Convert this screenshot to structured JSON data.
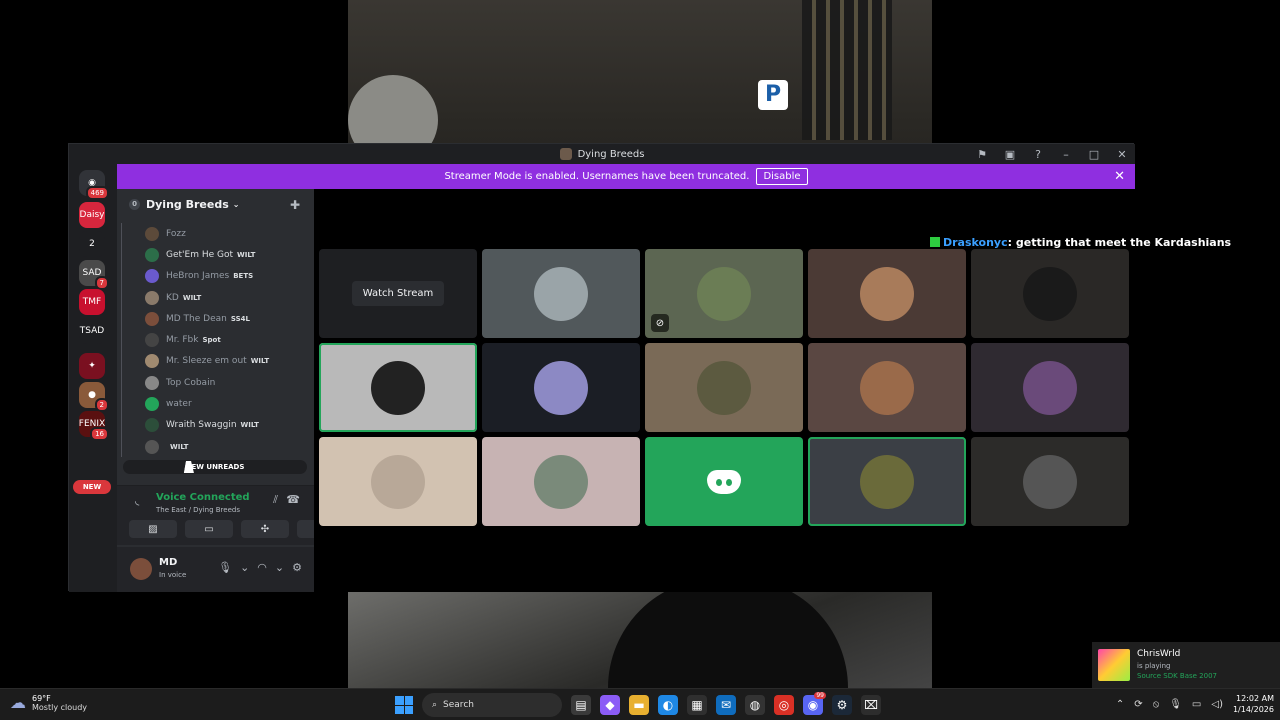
{
  "window": {
    "title": "Dying Breeds",
    "controls": [
      "flag-icon",
      "screen-icon",
      "help-icon",
      "minimize-icon",
      "maximize-icon",
      "close-icon"
    ]
  },
  "banner": {
    "text": "Streamer Mode is enabled. Usernames have been truncated.",
    "button": "Disable"
  },
  "rail": {
    "home_badge": "469",
    "servers": [
      {
        "label": "Daisy",
        "color": "#d7263d",
        "badge": ""
      },
      {
        "label": "2",
        "color": "#1e1f22",
        "badge": ""
      },
      {
        "label": "SAD",
        "color": "#4a4a4a",
        "badge": "7"
      },
      {
        "label": "TMF",
        "color": "#c8102e",
        "badge": ""
      },
      {
        "label": "TSAD",
        "color": "#1e1f22",
        "badge": ""
      },
      {
        "label": "✦",
        "color": "#7a1020",
        "badge": ""
      },
      {
        "label": "●",
        "color": "#8a5a3a",
        "badge": "2"
      },
      {
        "label": "FENIX",
        "color": "#5a1010",
        "badge": "16"
      }
    ],
    "new_label": "NEW"
  },
  "sidebar": {
    "server_name": "Dying Breeds",
    "count": "0",
    "members": [
      {
        "name": "Fozz",
        "tag": "",
        "color": "#5c4a3a",
        "bright": false
      },
      {
        "name": "Get'Em He Got",
        "tag": "WILT",
        "color": "#2c6e49",
        "bright": true
      },
      {
        "name": "HeBron James",
        "tag": "BETS",
        "color": "#6a5acd",
        "bright": false
      },
      {
        "name": "KD",
        "tag": "WILT",
        "color": "#8a7a6a",
        "bright": false
      },
      {
        "name": "MD The Dean",
        "tag": "SS4L",
        "color": "#7b4e3b",
        "bright": false
      },
      {
        "name": "Mr. Fbk",
        "tag": "Spot",
        "color": "#444",
        "bright": false
      },
      {
        "name": "Mr. Sleeze em out",
        "tag": "WILT",
        "color": "#a08a70",
        "bright": false
      },
      {
        "name": "Top Cobain",
        "tag": "",
        "color": "#888",
        "bright": false
      },
      {
        "name": "water",
        "tag": "",
        "color": "#23a55a",
        "bright": false
      },
      {
        "name": "Wraith Swaggin",
        "tag": "WILT",
        "color": "#2c4e3a",
        "bright": true
      },
      {
        "name": "",
        "tag": "WILT",
        "color": "#555",
        "bright": false
      }
    ],
    "new_unreads": "NEW UNREADS"
  },
  "voice": {
    "status": "Voice Connected",
    "channel": "The East / Dying Breeds",
    "buttons": [
      "camera-off-icon",
      "screen-share-icon",
      "activities-icon",
      "soundboard-icon"
    ]
  },
  "user": {
    "name": "MD",
    "status": "In voice"
  },
  "stage": {
    "chat_name": "Draskonyc",
    "chat_sep": ":",
    "chat_message": "getting that meet the Kardashians",
    "watch_stream": "Watch Stream",
    "tiles": [
      {
        "type": "watch",
        "bg": "#1e1f22",
        "speaking": false,
        "avatar": ""
      },
      {
        "type": "avatar",
        "bg": "#51585b",
        "speaking": false,
        "avatar": "#9aa4a8",
        "mute": false
      },
      {
        "type": "avatar",
        "bg": "#5c6652",
        "speaking": false,
        "avatar": "#6b7d55",
        "mute": true
      },
      {
        "type": "avatar",
        "bg": "#4b3a35",
        "speaking": false,
        "avatar": "#a87b5a",
        "mute": false
      },
      {
        "type": "avatar",
        "bg": "#2a2826",
        "speaking": false,
        "avatar": "#1a1a1a",
        "mute": false
      },
      {
        "type": "avatar",
        "bg": "#b9b9b9",
        "speaking": true,
        "avatar": "#222",
        "mute": false
      },
      {
        "type": "avatar",
        "bg": "#1b1e25",
        "speaking": false,
        "avatar": "#8c89c4",
        "mute": false
      },
      {
        "type": "avatar",
        "bg": "#7a6a57",
        "speaking": false,
        "avatar": "#5c5a40",
        "mute": false
      },
      {
        "type": "avatar",
        "bg": "#5a4742",
        "speaking": false,
        "avatar": "#9a6a4a",
        "mute": false
      },
      {
        "type": "avatar",
        "bg": "#2f2a31",
        "speaking": false,
        "avatar": "#6a4a7a",
        "mute": false
      },
      {
        "type": "avatar",
        "bg": "#d2c2b1",
        "speaking": false,
        "avatar": "#b8a898",
        "mute": false
      },
      {
        "type": "avatar",
        "bg": "#c7b3b3",
        "speaking": false,
        "avatar": "#7a8a7a",
        "mute": false
      },
      {
        "type": "discord",
        "bg": "#23a55a",
        "speaking": false,
        "avatar": "",
        "mute": false
      },
      {
        "type": "avatar",
        "bg": "#3b3f45",
        "speaking": true,
        "avatar": "#6a6a3a",
        "mute": false
      },
      {
        "type": "avatar",
        "bg": "#2c2b29",
        "speaking": false,
        "avatar": "#555",
        "mute": false
      }
    ]
  },
  "toast": {
    "name": "ChrisWrld",
    "line1": "is playing",
    "game": "Source SDK Base 2007"
  },
  "taskbar": {
    "temp": "69°F",
    "condition": "Mostly cloudy",
    "search": "Search",
    "discord_badge": "99",
    "time": "12:02 AM",
    "date": "1/14/2026"
  }
}
